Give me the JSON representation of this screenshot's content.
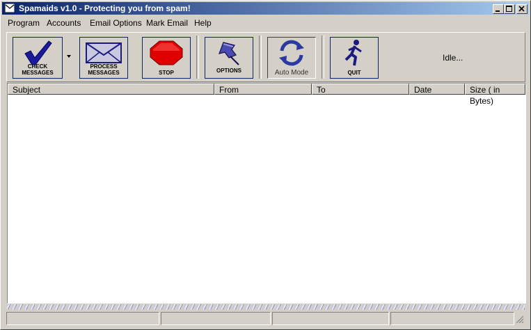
{
  "window": {
    "title": "Spamaids v1.0 - Protecting you from spam!"
  },
  "menu": [
    "Program",
    "Accounts",
    "Email Options",
    "Mark Email",
    "Help"
  ],
  "toolbar": {
    "check_messages": "CHECK MESSAGES",
    "process_messages_line1": "PROCESS",
    "process_messages_line2": "MESSAGES",
    "stop": "STOP",
    "options": "OPTIONS",
    "auto_mode": "Auto Mode",
    "quit": "QUIT",
    "status": "Idle..."
  },
  "table": {
    "columns": [
      "Subject",
      "From",
      "To",
      "Date",
      "Size ( in Bytes)"
    ],
    "rows": []
  },
  "colors": {
    "title_gradient_start": "#0a246a",
    "title_gradient_end": "#a6caf0",
    "button_border": "#0a246a",
    "stop_red": "#e00000"
  },
  "icons": [
    "app-mail-icon",
    "checkmark-icon",
    "dropdown-arrow-icon",
    "envelope-icon",
    "stop-sign-icon",
    "pushpin-icon",
    "refresh-arrows-icon",
    "running-man-icon"
  ]
}
